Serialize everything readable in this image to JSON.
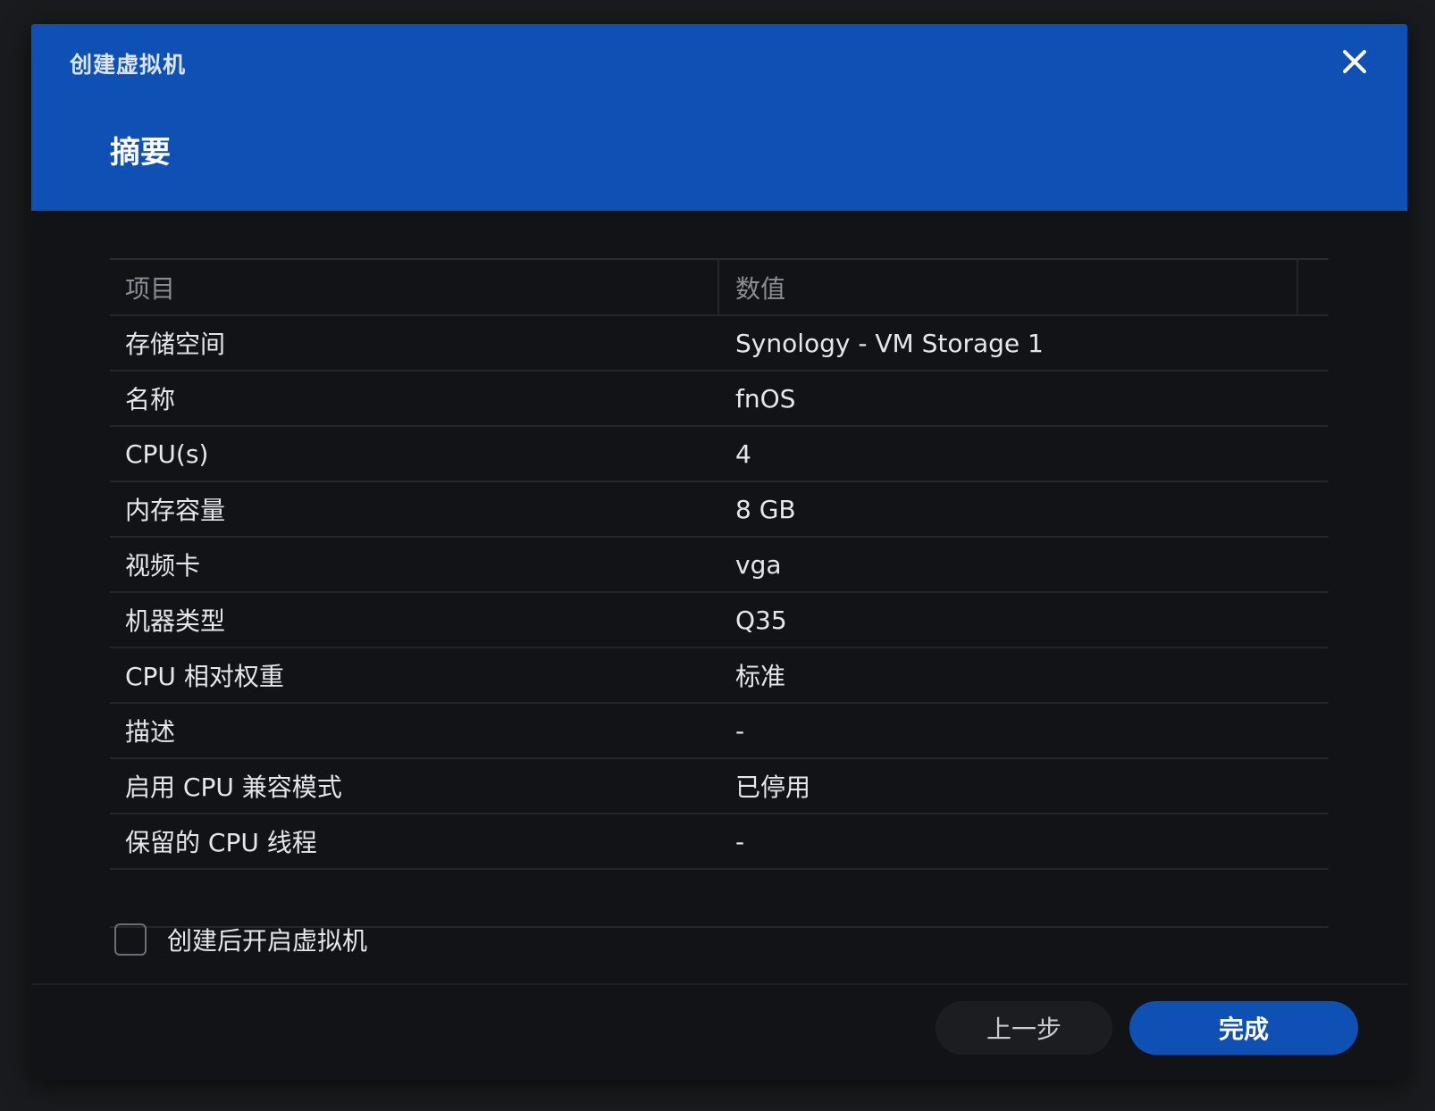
{
  "window": {
    "title": "创建虚拟机",
    "step_title": "摘要",
    "close_icon": "close-icon"
  },
  "table": {
    "headers": [
      "项目",
      "数值"
    ],
    "rows": [
      {
        "item": "存储空间",
        "value": "Synology - VM Storage 1"
      },
      {
        "item": "名称",
        "value": "fnOS"
      },
      {
        "item": "CPU(s)",
        "value": "4"
      },
      {
        "item": "内存容量",
        "value": "8 GB"
      },
      {
        "item": "视频卡",
        "value": "vga"
      },
      {
        "item": "机器类型",
        "value": "Q35"
      },
      {
        "item": "CPU 相对权重",
        "value": "标准"
      },
      {
        "item": "描述",
        "value": "-"
      },
      {
        "item": "启用 CPU 兼容模式",
        "value": "已停用"
      },
      {
        "item": "保留的 CPU 线程",
        "value": "-"
      }
    ]
  },
  "options": {
    "start_after_create_label": "创建后开启虚拟机",
    "start_after_create_checked": false
  },
  "footer": {
    "prev_label": "上一步",
    "finish_label": "完成"
  },
  "colors": {
    "accent": "#0e50b3",
    "background": "#111316"
  }
}
